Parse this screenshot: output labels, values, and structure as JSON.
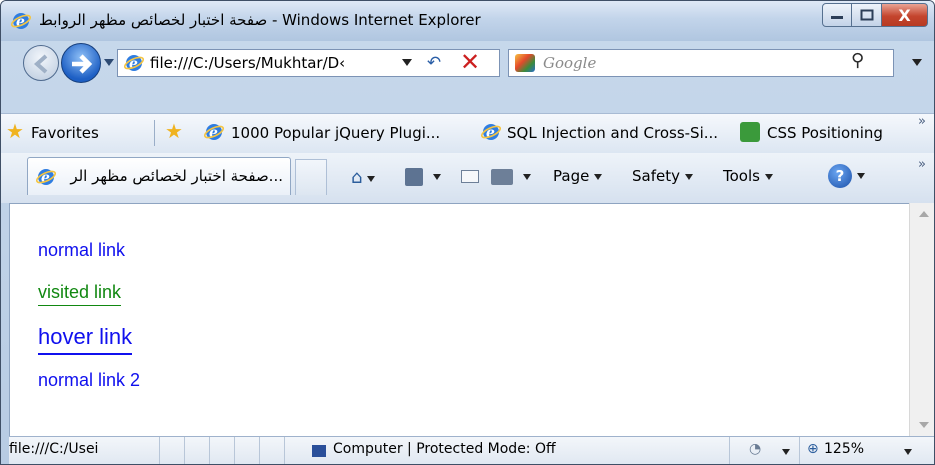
{
  "window": {
    "title": "صفحة اختبار لخصائص مظهر الروابط - Windows Internet Explorer",
    "buttons": {
      "minimize": "—",
      "maximize": "☐",
      "close": "X"
    }
  },
  "navigation": {
    "address": "file:///C:/Users/Mukhtar/D‹",
    "search_placeholder": "Google",
    "refresh_icon": "refresh-icon",
    "stop_icon": "stop-icon"
  },
  "favorites_bar": {
    "favorites_label": "Favorites",
    "items": [
      "1000 Popular jQuery Plugi...",
      "SQL Injection and Cross-Si...",
      "CSS Positioning"
    ]
  },
  "tabs": [
    {
      "label": "...صفحة اختبار لخصائص مظهر الر"
    }
  ],
  "command_bar": {
    "page": "Page",
    "safety": "Safety",
    "tools": "Tools"
  },
  "content": {
    "links": [
      {
        "label": "normal link",
        "state": "normal"
      },
      {
        "label": "visited link",
        "state": "visited"
      },
      {
        "label": "hover link",
        "state": "hover"
      },
      {
        "label": "normal link 2",
        "state": "normal"
      }
    ],
    "colors": {
      "normal": "#1010ee",
      "visited": "#118811"
    }
  },
  "status_bar": {
    "left": "file:///C:/Usei",
    "zone": "Computer | Protected Mode: Off",
    "zoom": "125%"
  }
}
